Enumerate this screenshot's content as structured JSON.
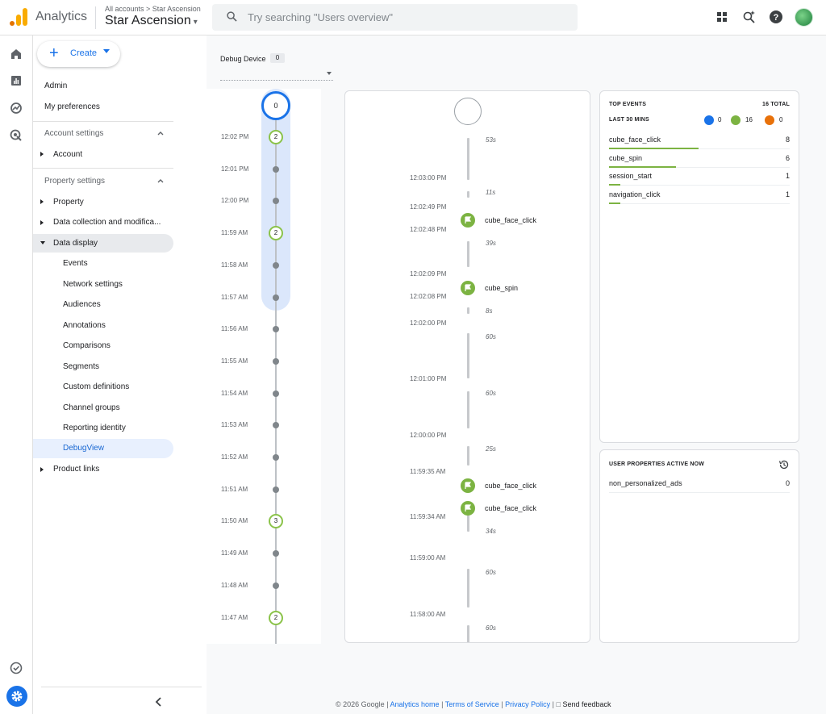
{
  "header": {
    "app_name": "Analytics",
    "breadcrumb": "All accounts > Star Ascension",
    "property": "Star Ascension",
    "search_placeholder": "Try searching \"Users overview\""
  },
  "nav": {
    "create_label": "Create",
    "admin": "Admin",
    "preferences": "My preferences",
    "account_settings": "Account settings",
    "account": "Account",
    "property_settings": "Property settings",
    "property": "Property",
    "data_collection": "Data collection and modifica...",
    "data_display": "Data display",
    "sub_items": [
      "Events",
      "Network settings",
      "Audiences",
      "Annotations",
      "Comparisons",
      "Segments",
      "Custom definitions",
      "Channel groups",
      "Reporting identity",
      "DebugView"
    ],
    "product_links": "Product links"
  },
  "debug_device": {
    "label": "Debug Device",
    "count": "0"
  },
  "minutes": {
    "top_count": "0",
    "rows": [
      {
        "time": "12:02 PM",
        "count": "2"
      },
      {
        "time": "12:01 PM",
        "count": ""
      },
      {
        "time": "12:00 PM",
        "count": ""
      },
      {
        "time": "11:59 AM",
        "count": "2"
      },
      {
        "time": "11:58 AM",
        "count": ""
      },
      {
        "time": "11:57 AM",
        "count": ""
      },
      {
        "time": "11:56 AM",
        "count": ""
      },
      {
        "time": "11:55 AM",
        "count": ""
      },
      {
        "time": "11:54 AM",
        "count": ""
      },
      {
        "time": "11:53 AM",
        "count": ""
      },
      {
        "time": "11:52 AM",
        "count": ""
      },
      {
        "time": "11:51 AM",
        "count": ""
      },
      {
        "time": "11:50 AM",
        "count": "3"
      },
      {
        "time": "11:49 AM",
        "count": ""
      },
      {
        "time": "11:48 AM",
        "count": ""
      },
      {
        "time": "11:47 AM",
        "count": "2"
      }
    ]
  },
  "stream": {
    "durations": [
      "53s",
      "11s",
      "39s",
      "8s",
      "60s",
      "60s",
      "25s",
      "34s",
      "60s",
      "60s"
    ],
    "times": [
      "12:03:00 PM",
      "12:02:49 PM",
      "12:02:48 PM",
      "12:02:09 PM",
      "12:02:08 PM",
      "12:02:00 PM",
      "12:01:00 PM",
      "12:00:00 PM",
      "11:59:35 AM",
      "11:59:34 AM",
      "11:59:00 AM",
      "11:58:00 AM"
    ],
    "events": [
      "cube_face_click",
      "cube_spin",
      "cube_face_click",
      "cube_face_click"
    ]
  },
  "top_events": {
    "title": "TOP EVENTS",
    "total": "16 TOTAL",
    "period": "LAST 30 MINS",
    "users_count": "0",
    "events_count": "16",
    "errors_count": "0",
    "rows": [
      {
        "name": "cube_face_click",
        "count": "8"
      },
      {
        "name": "cube_spin",
        "count": "6"
      },
      {
        "name": "session_start",
        "count": "1"
      },
      {
        "name": "navigation_click",
        "count": "1"
      }
    ]
  },
  "user_props": {
    "title": "USER PROPERTIES ACTIVE NOW",
    "rows": [
      {
        "name": "non_personalized_ads",
        "value": "0"
      }
    ]
  },
  "footer": {
    "copyright": "© 2026 Google",
    "analytics_home": "Analytics home",
    "terms": "Terms of Service",
    "privacy": "Privacy Policy",
    "feedback": "Send feedback"
  }
}
